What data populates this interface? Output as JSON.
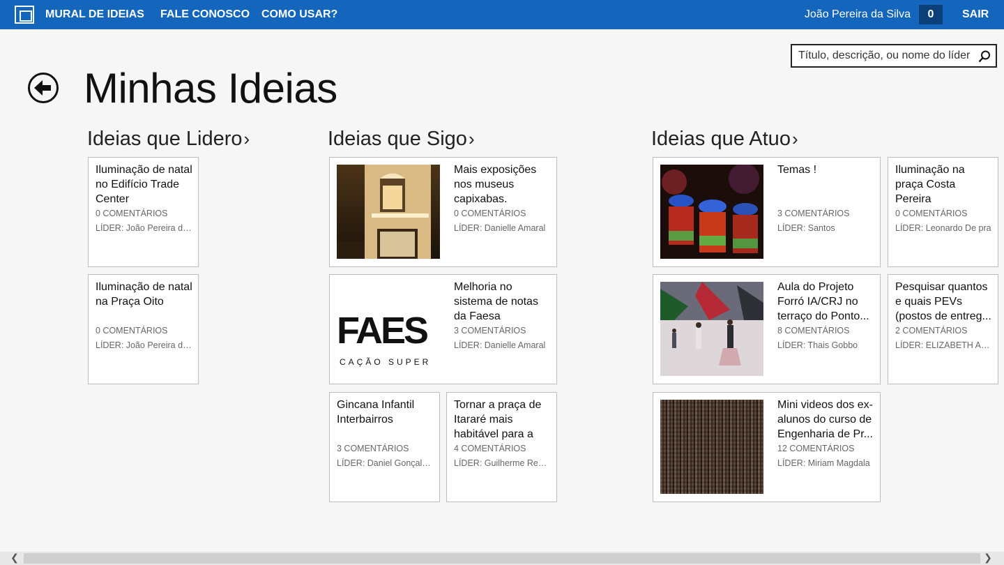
{
  "topbar": {
    "nav": [
      "MURAL DE IDEIAS",
      "FALE CONOSCO",
      "COMO USAR?"
    ],
    "user_name": "João Pereira da Silva",
    "count": "0",
    "logout": "SAIR"
  },
  "search": {
    "placeholder": "Título, descrição, ou nome do líder"
  },
  "page_title": "Minhas Ideias",
  "groups": [
    {
      "title": "Ideias que Lidero",
      "tiles": [
        {
          "title": "Iluminação de natal no Edifício Trade Center",
          "comments": "0  COMENTÁRIOS",
          "leader": "LÍDER:  João Pereira da Silva"
        },
        {
          "title": "Iluminação de natal na Praça Oito",
          "comments": "0  COMENTÁRIOS",
          "leader": "LÍDER:  João Pereira da Silva"
        }
      ]
    },
    {
      "title": "Ideias que Sigo",
      "tiles": [
        {
          "title": "Mais exposições nos museus capixabas.",
          "comments": "0  COMENTÁRIOS",
          "leader": "LÍDER:  Danielle Amaral",
          "image": "museum"
        },
        {
          "title": "Melhoria no sistema de notas da Faesa",
          "comments": "3  COMENTÁRIOS",
          "leader": "LÍDER:  Danielle Amaral",
          "image": "faes-logo",
          "logo_text": "FAES",
          "logo_sub": "CAÇÃO SUPER"
        },
        {
          "title": "Gincana Infantil Interbairros",
          "comments": "3  COMENTÁRIOS",
          "leader": "LÍDER:  Daniel Gonçalves"
        },
        {
          "title": "Tornar a praça de Itararé mais habitável para a c...",
          "comments": "4  COMENTÁRIOS",
          "leader": "LÍDER:  Guilherme Rebouças"
        }
      ]
    },
    {
      "title": "Ideias que Atuo",
      "tiles": [
        {
          "title": "Temas !",
          "comments": "3  COMENTÁRIOS",
          "leader": "LÍDER:  Santos",
          "image": "flaming-shots"
        },
        {
          "title": "Iluminação na praça Costa Pereira",
          "comments": "0  COMENTÁRIOS",
          "leader": "LÍDER:  Leonardo De pra"
        },
        {
          "title": "Aula do Projeto Forró IA/CRJ no terraço do Ponto...",
          "comments": "8  COMENTÁRIOS",
          "leader": "LÍDER:  Thais Gobbo",
          "image": "dance-class"
        },
        {
          "title": "Pesquisar quantos e quais PEVs (postos de entreg...",
          "comments": "2  COMENTÁRIOS",
          "leader": "LÍDER:  ELIZABETH ALVES"
        },
        {
          "title": "Mini videos dos ex-alunos do curso de Engenharia de Pr...",
          "comments": "12  COMENTÁRIOS",
          "leader": "LÍDER:  Miriam Magdala",
          "image": "photo-mosaic"
        }
      ]
    }
  ]
}
